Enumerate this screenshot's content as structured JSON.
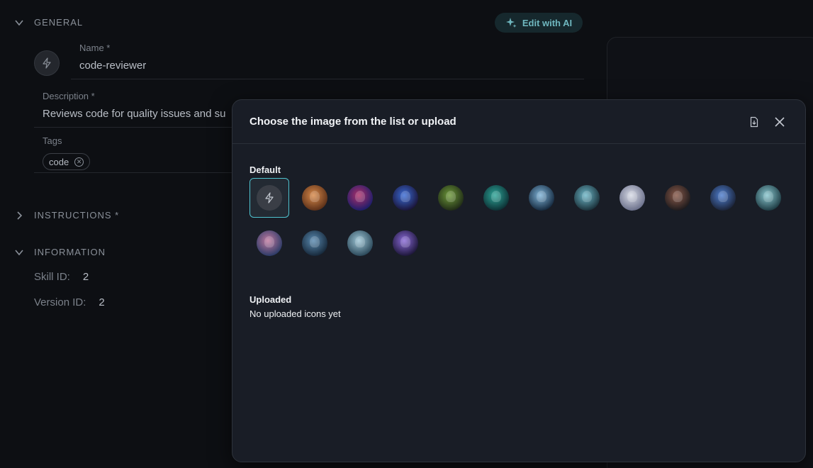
{
  "form": {
    "general_label": "GENERAL",
    "ai_button_label": "Edit with AI",
    "name_label": "Name *",
    "name_value": "code-reviewer",
    "description_label": "Description *",
    "description_value": "Reviews code for quality issues and su",
    "tags_label": "Tags",
    "tags": [
      "code"
    ],
    "instructions_label": "INSTRUCTIONS *",
    "information_label": "INFORMATION",
    "skill_id_label": "Skill ID:",
    "skill_id_value": "2",
    "version_id_label": "Version ID:",
    "version_id_value": "2"
  },
  "modal": {
    "title": "Choose the image from the list or upload",
    "default_label": "Default",
    "uploaded_label": "Uploaded",
    "uploaded_empty": "No uploaded icons yet",
    "icons": [
      {
        "name": "lightning-placeholder-icon",
        "selected": true,
        "colors": [
          "#3a3e46",
          "#3a3e46"
        ]
      },
      {
        "name": "orange-robot-avatar-icon",
        "selected": false,
        "colors": [
          "#d98a4a",
          "#5a2f18"
        ]
      },
      {
        "name": "circuit-board-avatar-icon",
        "selected": false,
        "colors": [
          "#b0306a",
          "#1b1d6a"
        ]
      },
      {
        "name": "neon-ring-avatar-icon",
        "selected": false,
        "colors": [
          "#3b6dd8",
          "#1a1438"
        ]
      },
      {
        "name": "green-chip-avatar-icon",
        "selected": false,
        "colors": [
          "#6e9a3a",
          "#1f2a16"
        ]
      },
      {
        "name": "teal-vortex-avatar-icon",
        "selected": false,
        "colors": [
          "#2ea89a",
          "#0c2f33"
        ]
      },
      {
        "name": "cyber-robot-avatar-icon",
        "selected": false,
        "colors": [
          "#7fb4d8",
          "#14283d"
        ]
      },
      {
        "name": "android-woman-avatar-icon",
        "selected": false,
        "colors": [
          "#6db8c9",
          "#1a2f38"
        ]
      },
      {
        "name": "silver-robot-avatar-icon",
        "selected": false,
        "colors": [
          "#d8dbe6",
          "#6a6f8a"
        ]
      },
      {
        "name": "dark-mech-avatar-icon",
        "selected": false,
        "colors": [
          "#8a5a4a",
          "#1d1a1c"
        ]
      },
      {
        "name": "blue-woman-avatar-icon",
        "selected": false,
        "colors": [
          "#4f7fd0",
          "#1a2236"
        ]
      },
      {
        "name": "glasses-man-avatar-icon",
        "selected": false,
        "colors": [
          "#8ac8d0",
          "#1d3a42"
        ]
      },
      {
        "name": "pink-bot-avatar-icon",
        "selected": false,
        "colors": [
          "#c27aa0",
          "#2a3a66"
        ]
      },
      {
        "name": "suit-man-avatar-icon",
        "selected": false,
        "colors": [
          "#5a8ab0",
          "#16283a"
        ]
      },
      {
        "name": "cyborg-face-avatar-icon",
        "selected": false,
        "colors": [
          "#9ec6d6",
          "#2a4758"
        ]
      },
      {
        "name": "particle-orb-avatar-icon",
        "selected": false,
        "colors": [
          "#8a6ad8",
          "#1c1638"
        ]
      }
    ]
  },
  "colors": {
    "accent": "#4fc3cf",
    "modal_bg": "#191d26",
    "page_bg": "#0d0f13"
  }
}
